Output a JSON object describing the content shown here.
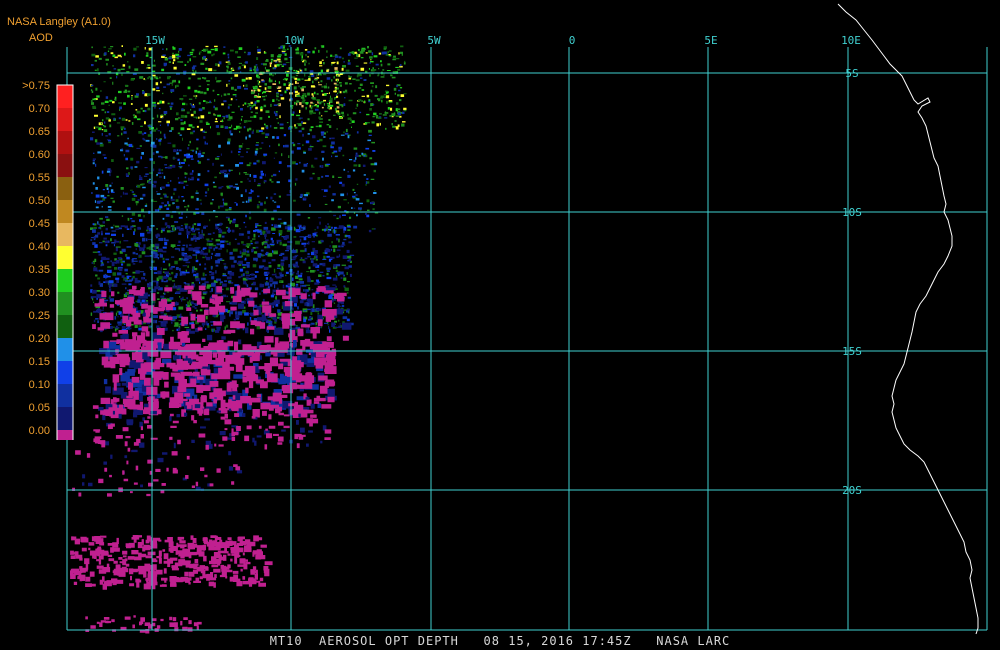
{
  "header": {
    "credit": "NASA Langley (A1.0)",
    "variable": "AOD"
  },
  "legend": {
    "labels": [
      ">0.75",
      "0.70",
      "0.65",
      "0.60",
      "0.55",
      "0.50",
      "0.45",
      "0.40",
      "0.35",
      "0.30",
      "0.25",
      "0.20",
      "0.15",
      "0.10",
      "0.05",
      "0.00"
    ],
    "colors": [
      "#ff2020",
      "#dd1818",
      "#b01010",
      "#8a1010",
      "#8a6010",
      "#c08820",
      "#e8b860",
      "#ffff30",
      "#20d020",
      "#209020",
      "#106010",
      "#2090e8",
      "#1040e8",
      "#1030a0",
      "#101870",
      "#c02090"
    ]
  },
  "grid": {
    "longitudes": [
      "15W",
      "10W",
      "5W",
      "0",
      "5E",
      "10E"
    ],
    "latitudes": [
      "5S",
      "10S",
      "15S",
      "20S"
    ],
    "color": "#40d0d0"
  },
  "footer": {
    "text": "MT10  AEROSOL OPT DEPTH   08 15, 2016 17:45Z   NASA LARC"
  }
}
